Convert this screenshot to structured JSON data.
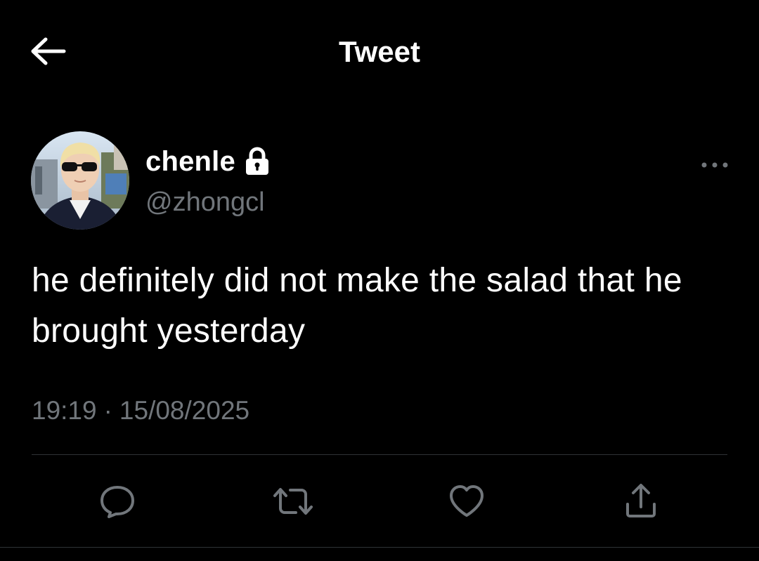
{
  "header": {
    "title": "Tweet",
    "back_icon": "arrow-left-icon"
  },
  "author": {
    "display_name": "chenle",
    "handle": "@zhongcl",
    "protected_icon": "lock-icon",
    "avatar": "avatar-photo"
  },
  "more_icon": "more-horizontal-icon",
  "tweet": {
    "text": "he definitely did not make the salad that he brought yesterday",
    "time": "19:19",
    "separator": "·",
    "date": "15/08/2025"
  },
  "actions": [
    {
      "name": "reply",
      "icon": "comment-icon"
    },
    {
      "name": "retweet",
      "icon": "retweet-icon"
    },
    {
      "name": "like",
      "icon": "heart-icon"
    },
    {
      "name": "share",
      "icon": "share-icon"
    }
  ],
  "colors": {
    "background": "#000000",
    "primary_text": "#ffffff",
    "secondary_text": "#71767b",
    "divider": "#2f3336",
    "icon": "#71767b"
  }
}
